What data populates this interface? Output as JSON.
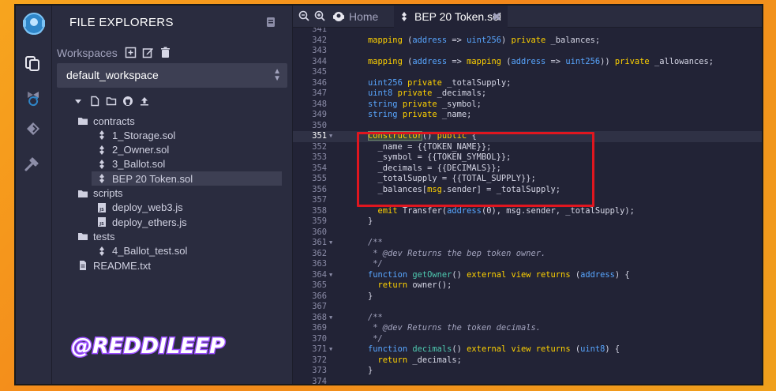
{
  "explorer": {
    "title": "FILE EXPLORERS",
    "workspaces_label": "Workspaces",
    "workspace_selected": "default_workspace",
    "tree": [
      {
        "label": "contracts",
        "kind": "folder",
        "depth": 0,
        "selected": false
      },
      {
        "label": "1_Storage.sol",
        "kind": "sol",
        "depth": 1,
        "selected": false
      },
      {
        "label": "2_Owner.sol",
        "kind": "sol",
        "depth": 1,
        "selected": false
      },
      {
        "label": "3_Ballot.sol",
        "kind": "sol",
        "depth": 1,
        "selected": false
      },
      {
        "label": "BEP 20 Token.sol",
        "kind": "sol",
        "depth": 1,
        "selected": true
      },
      {
        "label": "scripts",
        "kind": "folder",
        "depth": 0,
        "selected": false
      },
      {
        "label": "deploy_web3.js",
        "kind": "js",
        "depth": 1,
        "selected": false
      },
      {
        "label": "deploy_ethers.js",
        "kind": "js",
        "depth": 1,
        "selected": false
      },
      {
        "label": "tests",
        "kind": "folder",
        "depth": 0,
        "selected": false
      },
      {
        "label": "4_Ballot_test.sol",
        "kind": "sol",
        "depth": 1,
        "selected": false
      },
      {
        "label": "README.txt",
        "kind": "txt",
        "depth": 0,
        "selected": false
      }
    ],
    "watermark": "@REDDILEEP"
  },
  "tabs": {
    "home_label": "Home",
    "file_label": "BEP 20 Token.sol",
    "close_glyph": "✖"
  },
  "editor": {
    "active_line": 351,
    "lines": [
      {
        "n": 341,
        "fold": false,
        "code": ""
      },
      {
        "n": 342,
        "fold": false,
        "code": "    <span class='kw'>mapping</span> (<span class='ty'>address</span> => <span class='ty'>uint256</span>) <span class='kw'>private</span> _balances;"
      },
      {
        "n": 343,
        "fold": false,
        "code": ""
      },
      {
        "n": 344,
        "fold": false,
        "code": "    <span class='kw'>mapping</span> (<span class='ty'>address</span> => <span class='kw'>mapping</span> (<span class='ty'>address</span> => <span class='ty'>uint256</span>)) <span class='kw'>private</span> _allowances;"
      },
      {
        "n": 345,
        "fold": false,
        "code": ""
      },
      {
        "n": 346,
        "fold": false,
        "code": "    <span class='ty'>uint256</span> <span class='kw'>private</span> _totalSupply;"
      },
      {
        "n": 347,
        "fold": false,
        "code": "    <span class='ty'>uint8</span> <span class='kw'>private</span> _decimals;"
      },
      {
        "n": 348,
        "fold": false,
        "code": "    <span class='ty'>string</span> <span class='kw'>private</span> _symbol;"
      },
      {
        "n": 349,
        "fold": false,
        "code": "    <span class='ty'>string</span> <span class='kw'>private</span> _name;"
      },
      {
        "n": 350,
        "fold": false,
        "code": ""
      },
      {
        "n": 351,
        "fold": true,
        "code": "    <span class='kw hl-ctor'>constructor</span>() <span class='kw'>public</span> {"
      },
      {
        "n": 352,
        "fold": false,
        "code": "      _name = {{TOKEN_NAME}};"
      },
      {
        "n": 353,
        "fold": false,
        "code": "      _symbol = {{TOKEN_SYMBOL}};"
      },
      {
        "n": 354,
        "fold": false,
        "code": "      _decimals = {{DECIMALS}};"
      },
      {
        "n": 355,
        "fold": false,
        "code": "      _totalSupply = {{TOTAL_SUPPLY}};"
      },
      {
        "n": 356,
        "fold": false,
        "code": "      _balances[<span class='kw'>msg</span>.sender] = _totalSupply;"
      },
      {
        "n": 357,
        "fold": false,
        "code": ""
      },
      {
        "n": 358,
        "fold": false,
        "code": "      <span class='kw'>emit</span> Transfer(<span class='ty'>address</span>(0), msg.sender, _totalSupply);"
      },
      {
        "n": 359,
        "fold": false,
        "code": "    }"
      },
      {
        "n": 360,
        "fold": false,
        "code": ""
      },
      {
        "n": 361,
        "fold": true,
        "code": "    <span class='cm'>/**</span>"
      },
      {
        "n": 362,
        "fold": false,
        "code": "     <span class='cm'>* @dev Returns the bep token owner.</span>"
      },
      {
        "n": 363,
        "fold": false,
        "code": "     <span class='cm'>*/</span>"
      },
      {
        "n": 364,
        "fold": true,
        "code": "    <span class='ty'>function</span> <span class='fn'>getOwner</span>() <span class='kw'>external</span> <span class='kw'>view</span> <span class='kw'>returns</span> (<span class='ty'>address</span>) {"
      },
      {
        "n": 365,
        "fold": false,
        "code": "      <span class='kw'>return</span> owner();"
      },
      {
        "n": 366,
        "fold": false,
        "code": "    }"
      },
      {
        "n": 367,
        "fold": false,
        "code": ""
      },
      {
        "n": 368,
        "fold": true,
        "code": "    <span class='cm'>/**</span>"
      },
      {
        "n": 369,
        "fold": false,
        "code": "     <span class='cm'>* @dev Returns the token decimals.</span>"
      },
      {
        "n": 370,
        "fold": false,
        "code": "     <span class='cm'>*/</span>"
      },
      {
        "n": 371,
        "fold": true,
        "code": "    <span class='ty'>function</span> <span class='fn'>decimals</span>() <span class='kw'>external</span> <span class='kw'>view</span> <span class='kw'>returns</span> (<span class='ty'>uint8</span>) {"
      },
      {
        "n": 372,
        "fold": false,
        "code": "      <span class='kw'>return</span> _decimals;"
      },
      {
        "n": 373,
        "fold": false,
        "code": "    }"
      },
      {
        "n": 374,
        "fold": false,
        "code": ""
      }
    ]
  },
  "colors": {
    "background_orange": "#f3871a",
    "panel": "#2a2c3f",
    "editor": "#222336",
    "keyword": "#ffd200",
    "type": "#58a6ff",
    "highlight_box": "#e0161f"
  }
}
